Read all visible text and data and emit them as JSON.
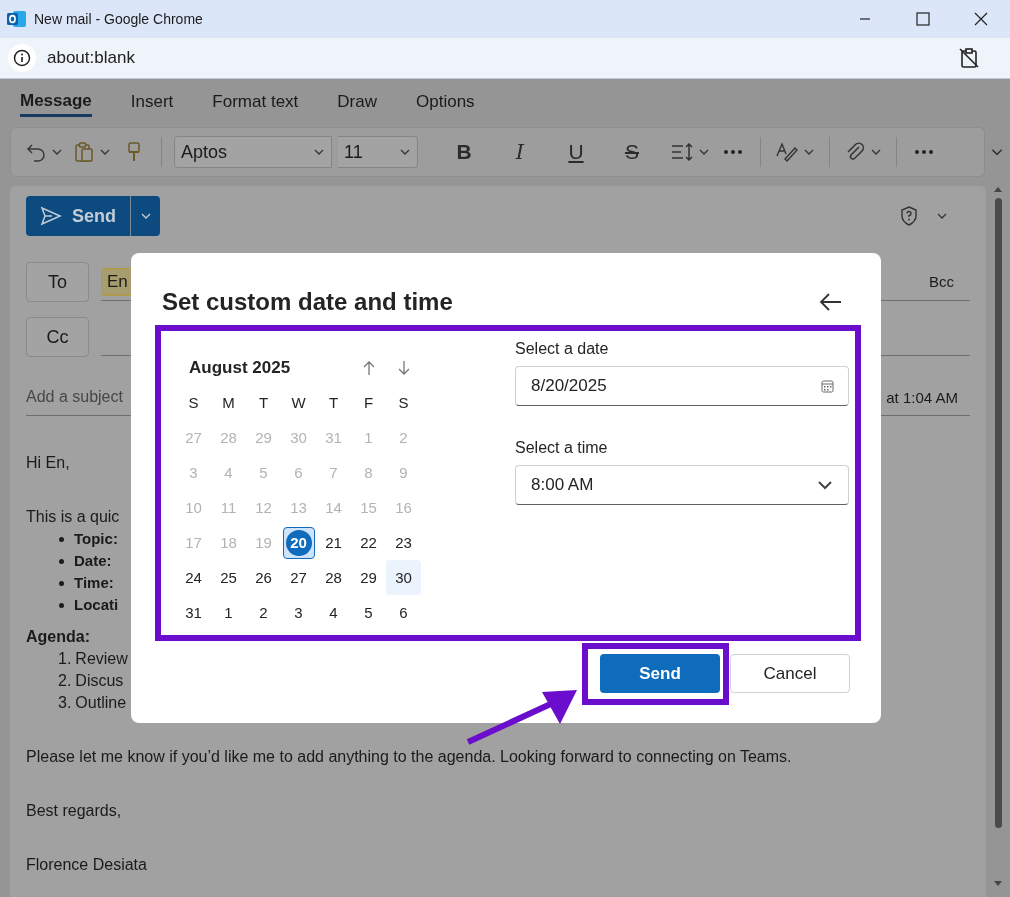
{
  "window": {
    "title": "New mail - Google Chrome",
    "url": "about:blank"
  },
  "ribbon": {
    "tabs": [
      {
        "label": "Message",
        "selected": true
      },
      {
        "label": "Insert",
        "selected": false
      },
      {
        "label": "Format text",
        "selected": false
      },
      {
        "label": "Draw",
        "selected": false
      },
      {
        "label": "Options",
        "selected": false
      }
    ]
  },
  "toolbar": {
    "font": "Aptos",
    "size": "11",
    "format_buttons": [
      {
        "label": "B",
        "kind": "bold"
      },
      {
        "label": "I",
        "kind": "italic"
      },
      {
        "label": "U",
        "kind": "underline"
      },
      {
        "label": "S",
        "kind": "strike"
      }
    ]
  },
  "compose": {
    "send_label": "Send",
    "to_label": "To",
    "to_chip": "En",
    "bcc_label": "Bcc",
    "cc_label": "Cc",
    "subject_placeholder": "Add a subject",
    "saved_note": "at 1:04 AM",
    "body": {
      "greeting": "Hi En,",
      "intro": "This is a quic",
      "bullets": [
        "Topic:",
        "Date:",
        "Time:",
        "Locati"
      ],
      "agenda_title": "Agenda:",
      "agenda": [
        {
          "number": "1.",
          "text": "Review"
        },
        {
          "number": "2.",
          "text": "Discus"
        },
        {
          "number": "3.",
          "text": "Outline"
        }
      ],
      "closing": "Please let me know if you’d like me to add anything to the agenda. Looking forward to connecting on Teams.",
      "signoff": "Best regards,",
      "signature": "Florence Desiata"
    }
  },
  "dialog": {
    "title": "Set custom date and time",
    "month": "August 2025",
    "weekdays": [
      "S",
      "M",
      "T",
      "W",
      "T",
      "F",
      "S"
    ],
    "weeks": [
      [
        {
          "day": "27",
          "disabled": true,
          "selected": false,
          "highlighted": false
        },
        {
          "day": "28",
          "disabled": true,
          "selected": false,
          "highlighted": false
        },
        {
          "day": "29",
          "disabled": true,
          "selected": false,
          "highlighted": false
        },
        {
          "day": "30",
          "disabled": true,
          "selected": false,
          "highlighted": false
        },
        {
          "day": "31",
          "disabled": true,
          "selected": false,
          "highlighted": false
        },
        {
          "day": "1",
          "disabled": true,
          "selected": false,
          "highlighted": false
        },
        {
          "day": "2",
          "disabled": true,
          "selected": false,
          "highlighted": false
        }
      ],
      [
        {
          "day": "3",
          "disabled": true,
          "selected": false,
          "highlighted": false
        },
        {
          "day": "4",
          "disabled": true,
          "selected": false,
          "highlighted": false
        },
        {
          "day": "5",
          "disabled": true,
          "selected": false,
          "highlighted": false
        },
        {
          "day": "6",
          "disabled": true,
          "selected": false,
          "highlighted": false
        },
        {
          "day": "7",
          "disabled": true,
          "selected": false,
          "highlighted": false
        },
        {
          "day": "8",
          "disabled": true,
          "selected": false,
          "highlighted": false
        },
        {
          "day": "9",
          "disabled": true,
          "selected": false,
          "highlighted": false
        }
      ],
      [
        {
          "day": "10",
          "disabled": true,
          "selected": false,
          "highlighted": false
        },
        {
          "day": "11",
          "disabled": true,
          "selected": false,
          "highlighted": false
        },
        {
          "day": "12",
          "disabled": true,
          "selected": false,
          "highlighted": false
        },
        {
          "day": "13",
          "disabled": true,
          "selected": false,
          "highlighted": false
        },
        {
          "day": "14",
          "disabled": true,
          "selected": false,
          "highlighted": false
        },
        {
          "day": "15",
          "disabled": true,
          "selected": false,
          "highlighted": false
        },
        {
          "day": "16",
          "disabled": true,
          "selected": false,
          "highlighted": false
        }
      ],
      [
        {
          "day": "17",
          "disabled": true,
          "selected": false,
          "highlighted": false
        },
        {
          "day": "18",
          "disabled": true,
          "selected": false,
          "highlighted": false
        },
        {
          "day": "19",
          "disabled": true,
          "selected": false,
          "highlighted": false
        },
        {
          "day": "20",
          "disabled": false,
          "selected": true,
          "highlighted": false
        },
        {
          "day": "21",
          "disabled": false,
          "selected": false,
          "highlighted": false
        },
        {
          "day": "22",
          "disabled": false,
          "selected": false,
          "highlighted": false
        },
        {
          "day": "23",
          "disabled": false,
          "selected": false,
          "highlighted": false
        }
      ],
      [
        {
          "day": "24",
          "disabled": false,
          "selected": false,
          "highlighted": false
        },
        {
          "day": "25",
          "disabled": false,
          "selected": false,
          "highlighted": false
        },
        {
          "day": "26",
          "disabled": false,
          "selected": false,
          "highlighted": false
        },
        {
          "day": "27",
          "disabled": false,
          "selected": false,
          "highlighted": false
        },
        {
          "day": "28",
          "disabled": false,
          "selected": false,
          "highlighted": false
        },
        {
          "day": "29",
          "disabled": false,
          "selected": false,
          "highlighted": false
        },
        {
          "day": "30",
          "disabled": false,
          "selected": false,
          "highlighted": true
        }
      ],
      [
        {
          "day": "31",
          "disabled": false,
          "selected": false,
          "highlighted": false
        },
        {
          "day": "1",
          "disabled": false,
          "selected": false,
          "highlighted": false
        },
        {
          "day": "2",
          "disabled": false,
          "selected": false,
          "highlighted": false
        },
        {
          "day": "3",
          "disabled": false,
          "selected": false,
          "highlighted": false
        },
        {
          "day": "4",
          "disabled": false,
          "selected": false,
          "highlighted": false
        },
        {
          "day": "5",
          "disabled": false,
          "selected": false,
          "highlighted": false
        },
        {
          "day": "6",
          "disabled": false,
          "selected": false,
          "highlighted": false
        }
      ]
    ],
    "date_label": "Select a date",
    "date_value": "8/20/2025",
    "time_label": "Select a time",
    "time_value": "8:00 AM",
    "buttons": [
      {
        "label": "Send",
        "kind": "primary"
      },
      {
        "label": "Cancel",
        "kind": "secondary"
      }
    ]
  }
}
